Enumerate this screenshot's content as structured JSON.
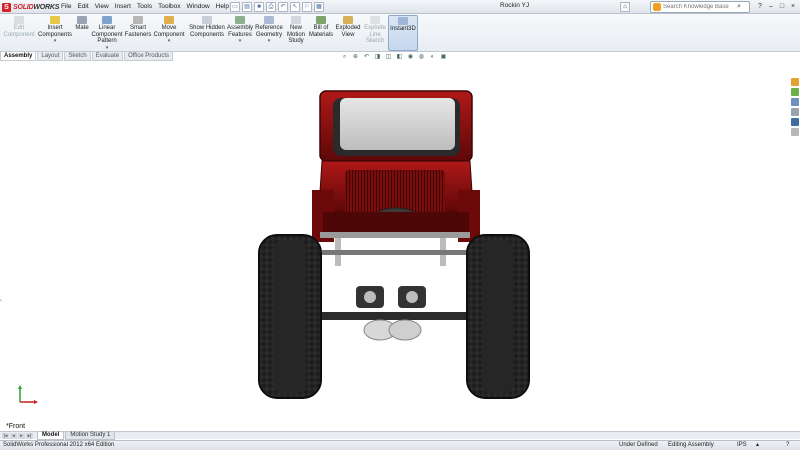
{
  "app": {
    "logo_mark": "S",
    "logo_text_red": "SOLID",
    "logo_text_dark": "WORKS",
    "document_title": "Rockin YJ"
  },
  "menu": [
    "File",
    "Edit",
    "View",
    "Insert",
    "Tools",
    "Toolbox",
    "Window",
    "Help"
  ],
  "search": {
    "placeholder": "Search Knowledge Base"
  },
  "ribbon": [
    {
      "label": "Edit Component",
      "icon": "edit-component-icon",
      "enabled": false
    },
    {
      "label": "Insert Components",
      "icon": "insert-components-icon",
      "enabled": true
    },
    {
      "label": "Mate",
      "icon": "mate-icon",
      "enabled": true
    },
    {
      "label": "Linear Component Pattern",
      "icon": "linear-pattern-icon",
      "enabled": true
    },
    {
      "label": "Smart Fasteners",
      "icon": "smart-fasteners-icon",
      "enabled": true
    },
    {
      "label": "Move Component",
      "icon": "move-component-icon",
      "enabled": true
    },
    {
      "label": "Show Hidden Components",
      "icon": "show-hidden-icon",
      "enabled": true
    },
    {
      "label": "Assembly Features",
      "icon": "assembly-features-icon",
      "enabled": true
    },
    {
      "label": "Reference Geometry",
      "icon": "reference-geometry-icon",
      "enabled": true
    },
    {
      "label": "New Motion Study",
      "icon": "motion-study-icon",
      "enabled": true
    },
    {
      "label": "Bill of Materials",
      "icon": "bill-of-materials-icon",
      "enabled": true
    },
    {
      "label": "Exploded View",
      "icon": "exploded-view-icon",
      "enabled": true
    },
    {
      "label": "Explode Line Sketch",
      "icon": "explode-line-icon",
      "enabled": false
    },
    {
      "label": "Instant3D",
      "icon": "instant3d-icon",
      "enabled": true,
      "active": true
    }
  ],
  "tabs": [
    "Assembly",
    "Layout",
    "Sketch",
    "Evaluate",
    "Office Products"
  ],
  "active_tab": "Assembly",
  "viewport": {
    "view_orientation": "*Front"
  },
  "bottom_tabs": [
    "Model",
    "Motion Study 1"
  ],
  "status": {
    "product": "SolidWorks Professional 2012 x64 Edition",
    "definition": "Under Defined",
    "mode": "Editing Assembly",
    "units": "IPS"
  },
  "colors": {
    "body_red": "#8c1010",
    "tire": "#1c1c1c",
    "accent_blue": "#4a6fa5"
  }
}
